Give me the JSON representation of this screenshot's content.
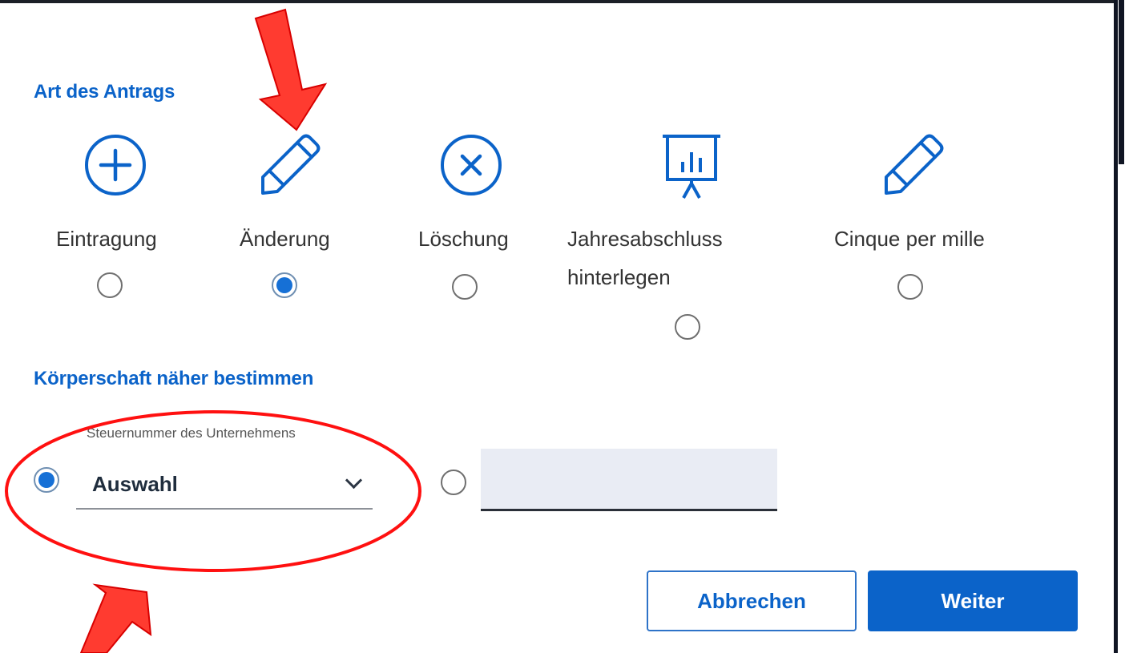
{
  "section1": {
    "title": "Art des Antrags"
  },
  "options": [
    {
      "label": "Eintragung",
      "icon": "plus-circle-icon",
      "checked": false
    },
    {
      "label": "Änderung",
      "icon": "pencil-icon",
      "checked": true
    },
    {
      "label": "Löschung",
      "icon": "x-circle-icon",
      "checked": false
    },
    {
      "label_line1": "Jahresabschluss",
      "label_line2": "hinterlegen",
      "icon": "presentation-chart-icon",
      "checked": false
    },
    {
      "label": "Cinque per mille",
      "icon": "pencil-icon",
      "checked": false
    }
  ],
  "section2": {
    "title": "Körperschaft näher bestimmen"
  },
  "selector": {
    "floating_label": "Steuernummer des Unternehmens",
    "value": "Auswahl",
    "radio_checked": true
  },
  "manual": {
    "value": "",
    "radio_checked": false
  },
  "buttons": {
    "cancel": "Abbrechen",
    "next": "Weiter"
  },
  "colors": {
    "primary": "#0b63c9",
    "annotation": "#ff1f1f",
    "input_bg": "#e9ecf4"
  }
}
